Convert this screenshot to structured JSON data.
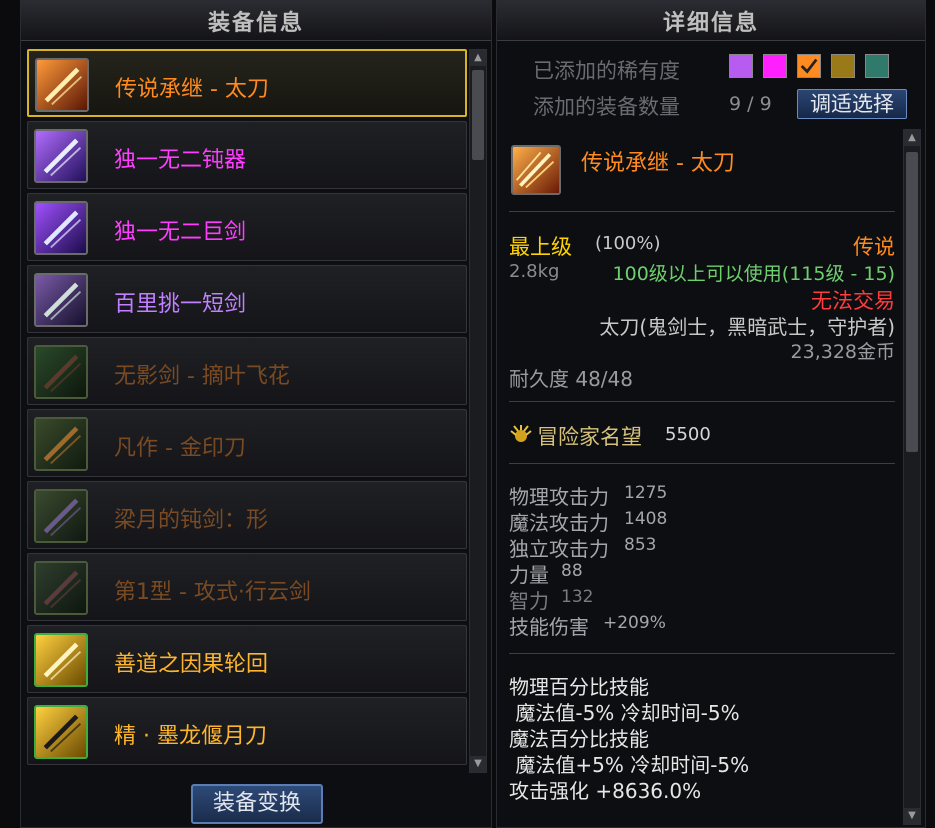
{
  "left_panel": {
    "title": "装备信息",
    "items": [
      {
        "name": "传说承继 - 太刀",
        "color": "#ff8a1f",
        "icon": "katana-icon",
        "selected": true
      },
      {
        "name": "独一无二钝器",
        "color": "#ff3cff",
        "icon": "blunt-weapon-icon"
      },
      {
        "name": "独一无二巨剑",
        "color": "#ff3cff",
        "icon": "greatsword-icon"
      },
      {
        "name": "百里挑一短剑",
        "color": "#c080ff",
        "icon": "shortsword-icon"
      },
      {
        "name": "无影剑 - 摘叶飞花",
        "color": "#7a4a22",
        "icon": "shadow-sword-icon"
      },
      {
        "name": "凡作 - 金印刀",
        "color": "#7a4a22",
        "icon": "golden-seal-blade-icon"
      },
      {
        "name": "梁月的钝剑：形",
        "color": "#7a4a22",
        "icon": "blunt-sword-icon"
      },
      {
        "name": "第1型 - 攻式·行云剑",
        "color": "#7a4a22",
        "icon": "cloud-sword-icon"
      },
      {
        "name": "善道之因果轮回",
        "color": "#ffb52a",
        "icon": "karma-cycle-icon"
      },
      {
        "name": "精 · 墨龙偃月刀",
        "color": "#ffb52a",
        "icon": "dragon-glaive-icon"
      }
    ],
    "swap_button": "装备变换"
  },
  "right_panel": {
    "title": "详细信息",
    "rarity_label": "已添加的稀有度",
    "rarity_colors": [
      "#b65cf0",
      "#ff1fff",
      "#ff8a1f",
      "#9a7a18",
      "#2f7a6a"
    ],
    "count_label": "添加的装备数量",
    "count_value": "9 / 9",
    "adjust_button": "调适选择"
  },
  "detail": {
    "name": "传说承继 - 太刀",
    "grade": "最上级",
    "grade_pct": "(100%)",
    "rarity": "传说",
    "weight": "2.8kg",
    "level_req": "100级以上可以使用(115级 - 15)",
    "trade": "无法交易",
    "classes": "太刀(鬼剑士，黑暗武士，守护者)",
    "price": "23,328金币",
    "durability": "耐久度 48/48",
    "fame_label": "冒险家名望",
    "fame_value": "5500",
    "stats": [
      {
        "label": "物理攻击力",
        "value": "1275"
      },
      {
        "label": "魔法攻击力",
        "value": "1408"
      },
      {
        "label": "独立攻击力",
        "value": "853"
      },
      {
        "label": "力量",
        "value": "88"
      },
      {
        "label": "智力",
        "value": "132"
      },
      {
        "label": "技能伤害",
        "value": "+209%"
      }
    ],
    "effects": [
      "物理百分比技能",
      " 魔法值-5% 冷却时间-5%",
      "魔法百分比技能",
      " 魔法值+5% 冷却时间-5%",
      "攻击强化 +8636.0%"
    ]
  }
}
